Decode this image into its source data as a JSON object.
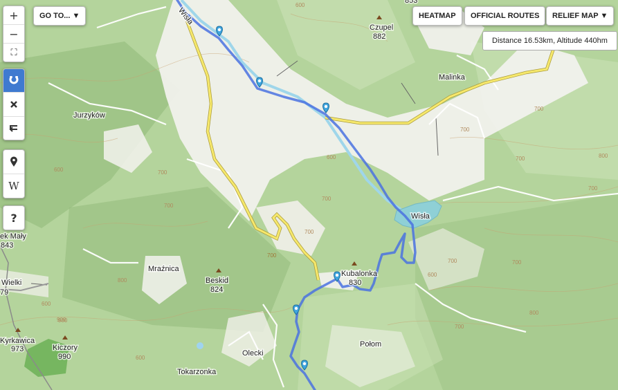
{
  "controls": {
    "zoom_in": "+",
    "zoom_out": "−",
    "fullscreen": "⛶",
    "goto_label": "GO TO... ▼",
    "heatmap_label": "HEATMAP",
    "official_routes_label": "OFFICIAL ROUTES",
    "relief_map_label": "RELIEF MAP ▼",
    "wiki_label": "W",
    "help_label": "?"
  },
  "tooltip": {
    "text": "Distance 16.53km, Altitude 440hm"
  },
  "places": {
    "czupel": "Czupel",
    "czupel_alt": "882",
    "top_peak_alt": "853",
    "malinka": "Malinka",
    "jurzykow": "Jurzyków",
    "wisla_lake": "Wisła",
    "wisla_river": "Wisła",
    "kubalonka": "Kubalonka",
    "kubalonka_alt": "830",
    "mraznica": "Mraźnica",
    "beskid": "Beskid",
    "beskid_alt": "824",
    "maly": "ek Mały",
    "maly_alt": "843",
    "wielki": "Wielki",
    "wielki_alt": "79",
    "kyrkawica": "Kyrkawica",
    "kyrkawica_alt": "973",
    "kiczory": "Kiczory",
    "kiczory_alt": "990",
    "olecki": "Olecki",
    "polom": "Połom",
    "tokarzonka": "Tokarzonka"
  },
  "contours": [
    "600",
    "700",
    "800",
    "900",
    "600",
    "700",
    "700",
    "700",
    "600",
    "700",
    "600",
    "800",
    "900",
    "600",
    "700",
    "700",
    "700",
    "700",
    "600",
    "700",
    "800",
    "700"
  ],
  "road_labels": [
    "700"
  ],
  "route": {
    "color": "#4a72e0"
  },
  "colors": {
    "forest": "#a9cc8e",
    "valley": "#f4f2ee",
    "road": "#f3e36a",
    "water": "#8ed3dc"
  }
}
